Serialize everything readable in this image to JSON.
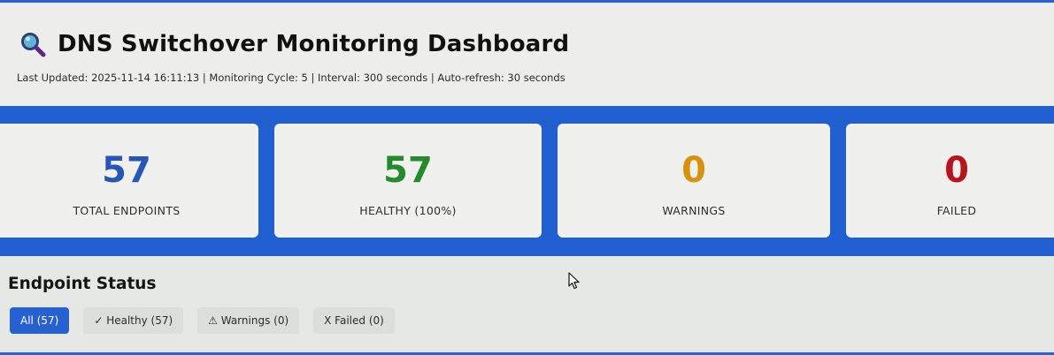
{
  "header": {
    "icon": "magnifier-icon",
    "title": "DNS Switchover Monitoring Dashboard",
    "subtitle": "Last Updated: 2025-11-14 16:11:13 | Monitoring Cycle: 5 | Interval: 300 seconds | Auto-refresh: 30 seconds"
  },
  "stats": {
    "total": {
      "value": "57",
      "label": "TOTAL ENDPOINTS",
      "color": "#2756b5"
    },
    "healthy": {
      "value": "57",
      "label": "HEALTHY (100%)",
      "color": "#238a2e"
    },
    "warnings": {
      "value": "0",
      "label": "WARNINGS",
      "color": "#d9920f"
    },
    "failed": {
      "value": "0",
      "label": "FAILED",
      "color": "#b8141b"
    }
  },
  "colors": {
    "accent": "#1f5fd0",
    "active_filter": "#2760cf"
  },
  "endpoint_status": {
    "title": "Endpoint Status",
    "filters": [
      {
        "label": "All (57)",
        "active": true
      },
      {
        "label": "✓ Healthy (57)",
        "active": false
      },
      {
        "label": "⚠ Warnings (0)",
        "active": false
      },
      {
        "label": "X Failed (0)",
        "active": false
      }
    ]
  }
}
